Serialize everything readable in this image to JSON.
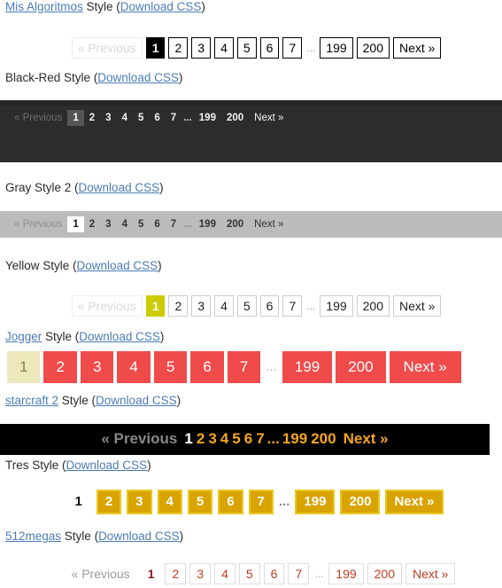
{
  "page": {
    "background": "#ffffff",
    "link_color": "#4b7cb5",
    "text_color": "#2a2a2a",
    "download_label": "Download CSS",
    "open_paren": "(",
    "close_paren": ")"
  },
  "sections": [
    {
      "id": "mis-algoritmos",
      "name": "Mis Algoritmos",
      "style_word": " Style ",
      "download": "Download CSS",
      "accent": "#000000",
      "pager": {
        "prev": "« Previous",
        "current": "1",
        "pages": [
          "2",
          "3",
          "4",
          "5",
          "6",
          "7"
        ],
        "dots": "...",
        "tail": [
          "199",
          "200"
        ],
        "next": "Next »"
      }
    },
    {
      "id": "black-red",
      "name": "Black-Red",
      "style_word": " Style ",
      "download": "Download CSS",
      "accent": "#2c2c2c",
      "pager": {
        "prev": "« Previous",
        "current": "1",
        "pages": [
          "2",
          "3",
          "4",
          "5",
          "6",
          "7"
        ],
        "dots": "...",
        "tail": [
          "199",
          "200"
        ],
        "next": "Next »"
      }
    },
    {
      "id": "gray-style-2",
      "name": "Gray Style 2",
      "style_word": " ",
      "download": "Download CSS",
      "accent": "#bbbbbb",
      "pager": {
        "prev": "« Previous",
        "current": "1",
        "pages": [
          "2",
          "3",
          "4",
          "5",
          "6",
          "7"
        ],
        "dots": "...",
        "tail": [
          "199",
          "200"
        ],
        "next": "Next »"
      }
    },
    {
      "id": "yellow",
      "name": "Yellow",
      "style_word": " Style ",
      "download": "Download CSS",
      "accent": "#cccc00",
      "pager": {
        "prev": "« Previous",
        "current": "1",
        "pages": [
          "2",
          "3",
          "4",
          "5",
          "6",
          "7"
        ],
        "dots": "...",
        "tail": [
          "199",
          "200"
        ],
        "next": "Next »"
      }
    },
    {
      "id": "jogger",
      "name": "Jogger",
      "style_word": " Style ",
      "download": "Download CSS",
      "accent": "#ef4b4b",
      "pager": {
        "current": "1",
        "pages": [
          "2",
          "3",
          "4",
          "5",
          "6",
          "7"
        ],
        "dots": "...",
        "tail": [
          "199",
          "200"
        ],
        "next": "Next »"
      }
    },
    {
      "id": "starcraft-2",
      "name": "starcraft 2",
      "style_word": " Style ",
      "download": "Download CSS",
      "accent": "#f5a623",
      "pager": {
        "prev": "« Previous",
        "current": "1",
        "pages": [
          "2",
          "3",
          "4",
          "5",
          "6",
          "7"
        ],
        "dots": "...",
        "tail": [
          "199",
          "200"
        ],
        "next": "Next »"
      }
    },
    {
      "id": "tres",
      "name": "Tres",
      "style_word": " Style ",
      "download": "Download CSS",
      "accent": "#d9a300",
      "pager": {
        "current": "1",
        "pages": [
          "2",
          "3",
          "4",
          "5",
          "6",
          "7"
        ],
        "dots": "...",
        "tail": [
          "199",
          "200"
        ],
        "next": "Next »"
      }
    },
    {
      "id": "512megas",
      "name": "512megas",
      "style_word": " Style ",
      "download": "Download CSS",
      "accent": "#c23b22",
      "pager": {
        "prev": "« Previous",
        "current": "1",
        "pages": [
          "2",
          "3",
          "4",
          "5",
          "6",
          "7"
        ],
        "dots": "...",
        "tail": [
          "199",
          "200"
        ],
        "next": "Next »"
      }
    }
  ]
}
